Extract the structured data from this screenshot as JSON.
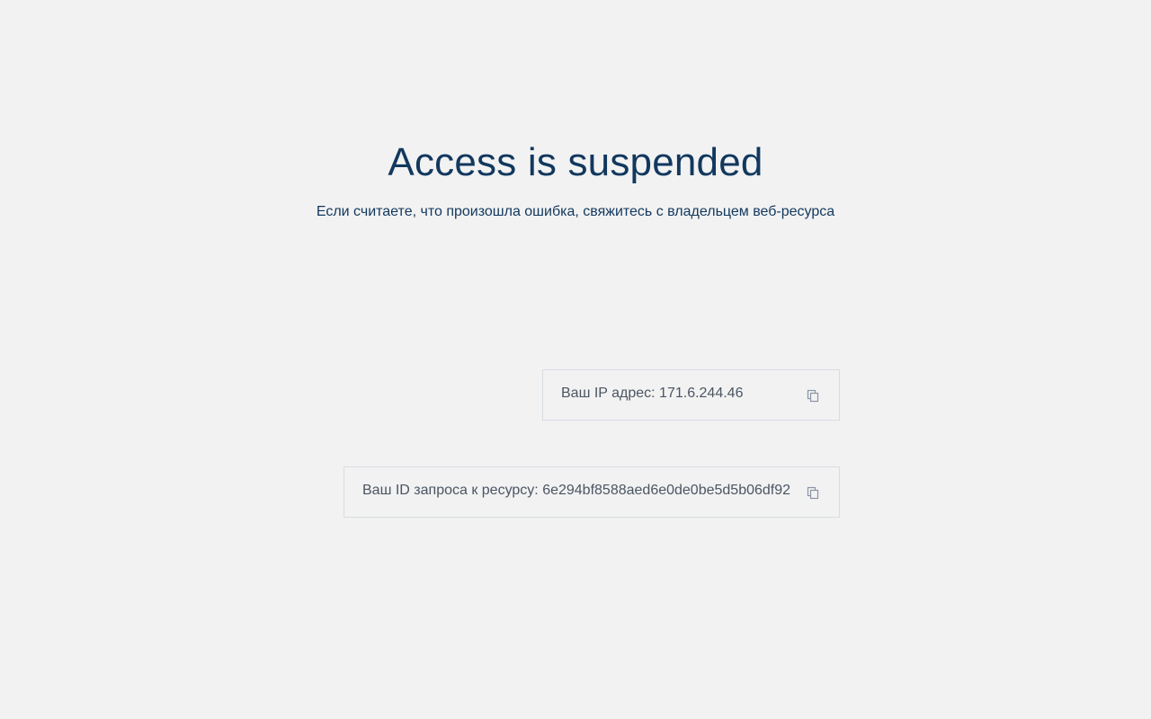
{
  "main": {
    "title": "Access is suspended",
    "subtitle": "Если считаете, что произошла ошибка, свяжитесь с владельцем веб-ресурса"
  },
  "info": {
    "ip_text": "Ваш IP адрес: 171.6.244.46",
    "request_text": "Ваш ID запроса к ресурсу: 6e294bf8588aed6e0de0be5d5b06df92"
  },
  "icons": {
    "copy": "copy-icon"
  },
  "colors": {
    "background": "#f2f2f2",
    "heading": "#12385e",
    "info_text": "#4b5563",
    "border": "#d7dde3",
    "icon": "#8a96a3"
  }
}
